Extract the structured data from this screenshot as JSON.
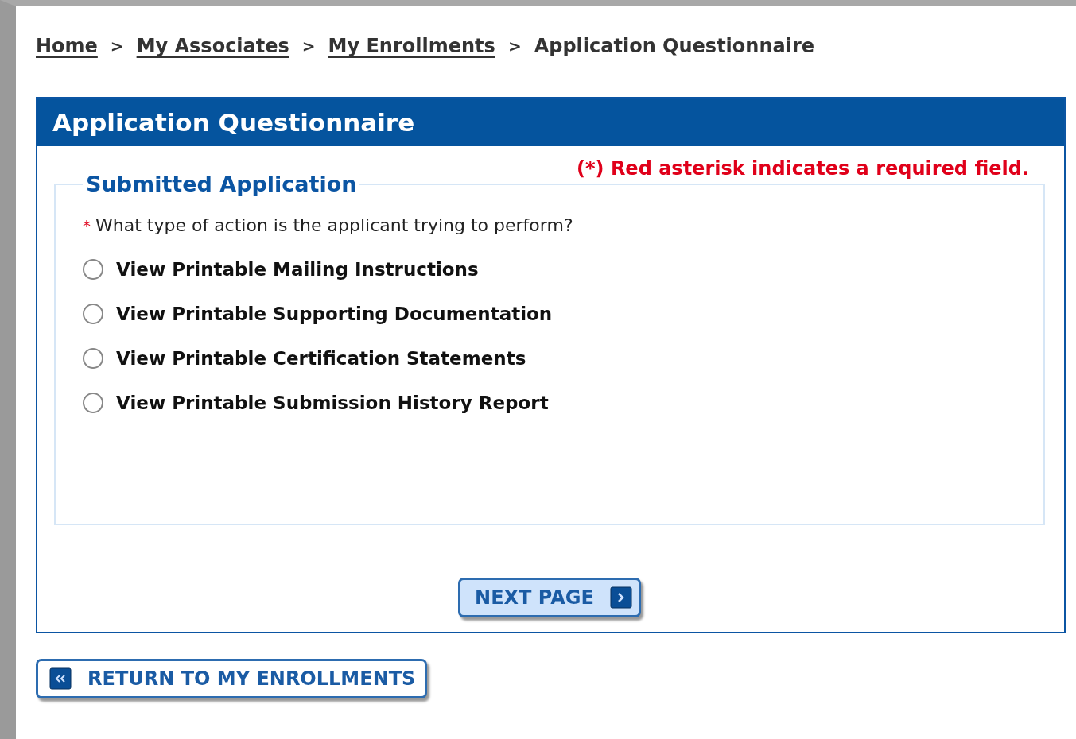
{
  "breadcrumb": [
    {
      "label": "Home",
      "link": true
    },
    {
      "label": "My Associates",
      "link": true
    },
    {
      "label": "My Enrollments",
      "link": true
    },
    {
      "label": "Application Questionnaire",
      "link": false
    }
  ],
  "breadcrumb_separator": ">",
  "panel": {
    "title": "Application Questionnaire",
    "required_note": "(*) Red asterisk indicates a required field.",
    "fieldset": {
      "legend": "Submitted Application",
      "question": {
        "required_mark": "*",
        "text": "What type of action is the applicant trying to perform?"
      },
      "options": [
        {
          "label": "View Printable Mailing Instructions",
          "selected": false
        },
        {
          "label": "View Printable Supporting Documentation",
          "selected": false
        },
        {
          "label": "View Printable Certification Statements",
          "selected": false
        },
        {
          "label": "View Printable Submission History Report",
          "selected": false
        }
      ]
    },
    "next_button": "NEXT PAGE"
  },
  "return_button": "RETURN TO MY ENROLLMENTS"
}
